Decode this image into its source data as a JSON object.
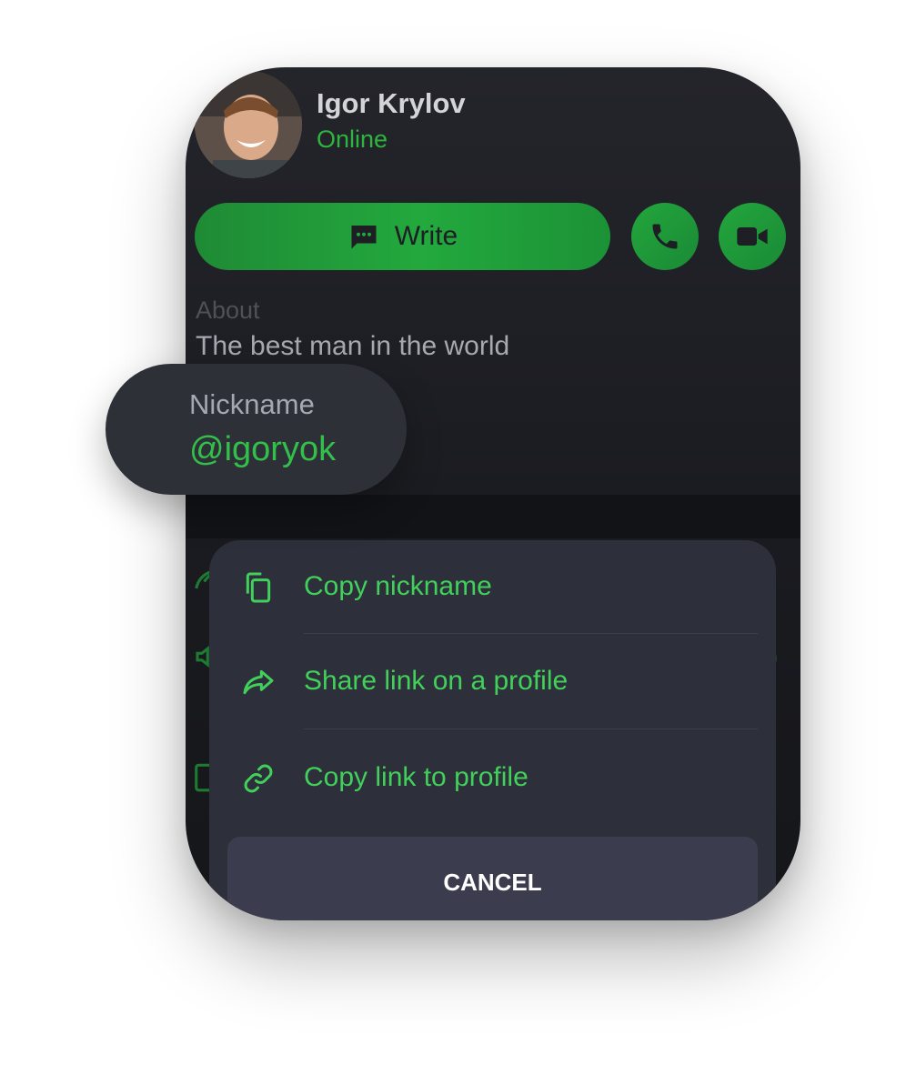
{
  "profile": {
    "name": "Igor Krylov",
    "status": "Online"
  },
  "actions": {
    "write_label": "Write"
  },
  "about": {
    "label": "About",
    "text": "The best man in the world"
  },
  "nickname": {
    "label": "Nickname",
    "value": "@igoryok"
  },
  "sheet": {
    "items": [
      {
        "label": "Copy nickname",
        "icon": "copy-icon"
      },
      {
        "label": "Share link on a profile",
        "icon": "share-icon"
      },
      {
        "label": "Copy link to profile",
        "icon": "link-icon"
      }
    ],
    "cancel_label": "CANCEL"
  },
  "colors": {
    "accent": "#2eb53f",
    "sheet_background": "#2d2f3b",
    "card_background": "#1e1f24"
  }
}
